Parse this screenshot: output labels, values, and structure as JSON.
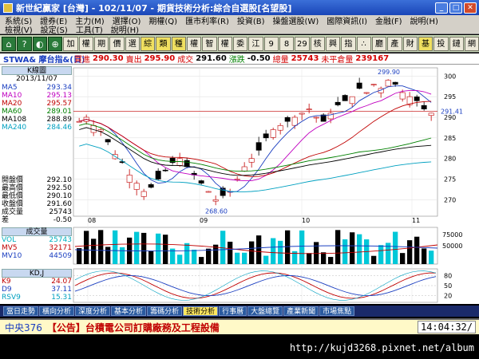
{
  "window": {
    "title": "新世紀贏家 [台灣] - 102/11/07 - 期貨技術分析:綜合自選股[名望股]"
  },
  "menu1": [
    "系統(S)",
    "證券(E)",
    "主力(M)",
    "選擇(O)",
    "期權(Q)",
    "匯市利率(R)",
    "投資(B)",
    "操盤選股(W)",
    "國際資訊(I)",
    "金融(F)",
    "說明(H)"
  ],
  "menu2": [
    "檢視(V)",
    "設定(S)",
    "工具(T)",
    "說明(H)"
  ],
  "toolbar": {
    "icons": [
      "⌂",
      "?",
      "◐",
      "⊕"
    ],
    "buttons": [
      "加",
      "權",
      "期",
      "價",
      "選",
      "綜",
      "類",
      "種",
      "權",
      "智",
      "權",
      "委",
      "江",
      "9",
      "8",
      "29",
      "核",
      "興",
      "指",
      "∴",
      "廳",
      "產",
      "財",
      "基",
      "投",
      "鏈",
      "網"
    ],
    "highlight": [
      5,
      6,
      7,
      23
    ]
  },
  "info": {
    "symbol": "STWA& 摩台指&(日)",
    "bid_label": "買進",
    "bid": "290.30",
    "ask_label": "賣出",
    "ask": "295.90",
    "last_label": "成交",
    "last": "291.60",
    "change_label": "漲跌",
    "change": "-0.50",
    "volume_label": "總量",
    "volume": "25743",
    "oi_label": "未平倉量",
    "oi": "239167"
  },
  "price_panel": {
    "title": "K線圖",
    "date": "2013/11/07",
    "ma": [
      {
        "name": "MA5",
        "value": "293.34",
        "color": "#1a3ec0"
      },
      {
        "name": "MA10",
        "value": "295.13",
        "color": "#c000c0"
      },
      {
        "name": "MA20",
        "value": "295.57",
        "color": "#c00000"
      },
      {
        "name": "MA60",
        "value": "289.01",
        "color": "#008000"
      },
      {
        "name": "MA108",
        "value": "288.89",
        "color": "#000000"
      },
      {
        "name": "MA240",
        "value": "284.46",
        "color": "#00a0c0"
      }
    ],
    "ohlc": [
      {
        "name": "開盤價",
        "value": "292.10"
      },
      {
        "name": "最高價",
        "value": "292.50"
      },
      {
        "name": "最低價",
        "value": "290.10"
      },
      {
        "name": "收盤價",
        "value": "291.60"
      },
      {
        "name": "成交量",
        "value": "25743"
      },
      {
        "name": "差",
        "value": "-0.50"
      }
    ],
    "high_mark": "299.90",
    "low_mark": "268.60",
    "current_mark": "291.41",
    "y_ticks": [
      "300",
      "295",
      "290",
      "285",
      "280",
      "275",
      "270"
    ],
    "x_ticks": [
      "08",
      "09",
      "10",
      "11"
    ]
  },
  "volume_panel": {
    "title": "成交量",
    "items": [
      {
        "name": "VOL",
        "value": "25743",
        "color": "#00b0c0"
      },
      {
        "name": "MV5",
        "value": "32171",
        "color": "#c00000"
      },
      {
        "name": "MV10",
        "value": "44509",
        "color": "#1a3ec0"
      }
    ],
    "y_ticks": [
      "75000",
      "50000"
    ]
  },
  "kd_panel": {
    "title": "KD,J",
    "items": [
      {
        "name": "K9",
        "value": "24.07",
        "color": "#c00000"
      },
      {
        "name": "D9",
        "value": "37.11",
        "color": "#1a3ec0"
      },
      {
        "name": "RSV9",
        "value": "15.31",
        "color": "#00a0c0"
      }
    ],
    "y_ticks": [
      "80",
      "50",
      "20"
    ]
  },
  "tabs": [
    "當日走勢",
    "橫向分析",
    "深度分析",
    "基本分析",
    "籌碼分析",
    "技術分析",
    "行事曆",
    "大盤總覽",
    "產業新聞",
    "市場焦點"
  ],
  "active_tab": 5,
  "status": {
    "code": "中央376",
    "message": "【公告】台積電公司訂購廠務及工程設備",
    "time": "14:04:32/"
  },
  "footer": {
    "url": "http://kujd3268.pixnet.net/album"
  }
}
